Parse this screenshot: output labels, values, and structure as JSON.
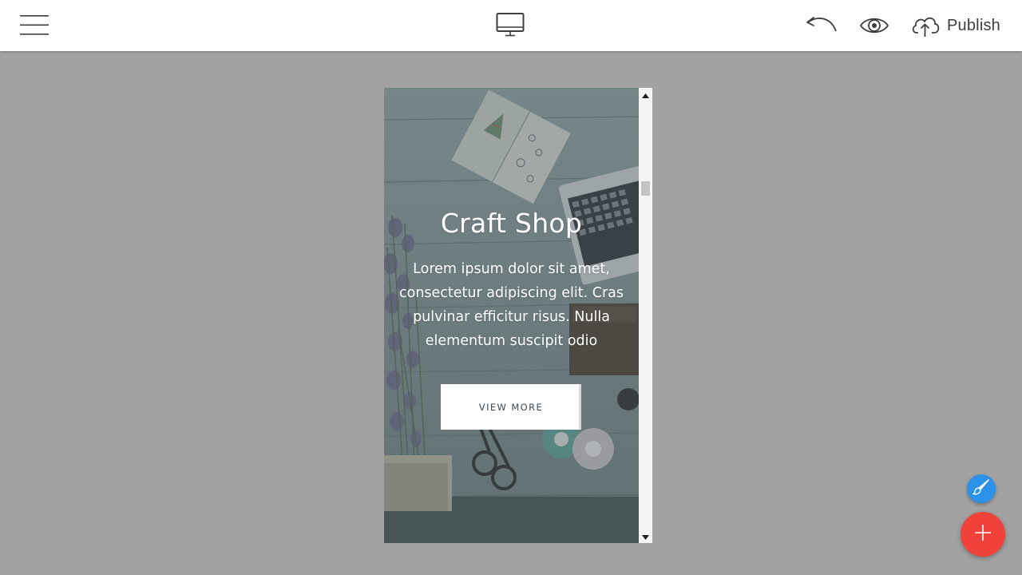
{
  "toolbar": {
    "menu_icon": "hamburger-menu-icon",
    "device_icon": "desktop-monitor-icon",
    "undo_icon": "undo-arrow-icon",
    "preview_icon": "eye-icon",
    "publish_icon": "cloud-upload-icon",
    "publish_label": "Publish",
    "icon_color": "#3d3d3d"
  },
  "preview": {
    "hero": {
      "title": "Craft Shop",
      "text": "Lorem ipsum dolor sit amet, consectetur adipiscing elit. Cras pulvinar efficitur risus. Nulla elementum suscipit odio",
      "button_label": "VIEW MORE",
      "background_image": "craft-table-flowers-laptop-photo"
    },
    "scrollbar": {
      "up_icon": "scroll-up-arrow-icon",
      "down_icon": "scroll-down-arrow-icon"
    }
  },
  "fabs": {
    "style_button_icon": "paint-brush-icon",
    "style_button_color": "#2b91e9",
    "add_button_icon": "plus-icon",
    "add_button_color": "#f0413a"
  },
  "colors": {
    "canvas_background": "#a2a2a2",
    "toolbar_background": "#ffffff"
  }
}
